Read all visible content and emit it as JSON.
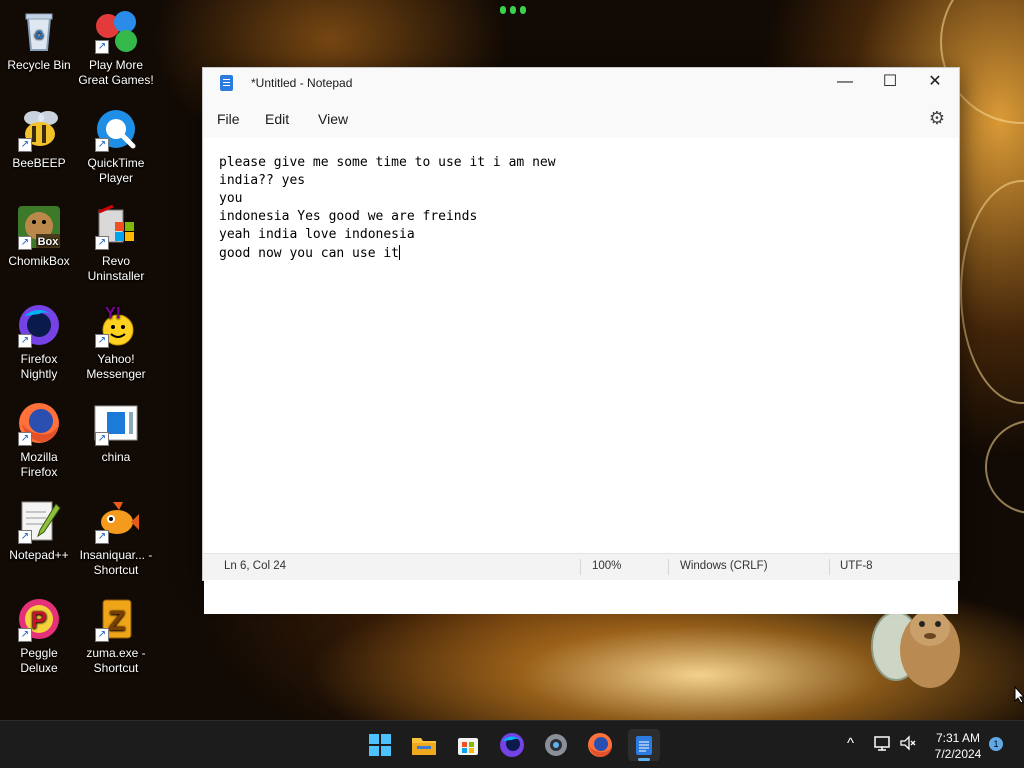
{
  "desktop": {
    "icons": [
      {
        "label": "Recycle Bin",
        "icon": "recycle-bin-icon"
      },
      {
        "label": "Play More Great Games!",
        "icon": "games-icon"
      },
      {
        "label": "BeeBEEP",
        "icon": "bee-icon"
      },
      {
        "label": "QuickTime Player",
        "icon": "quicktime-icon"
      },
      {
        "label": "ChomikBox",
        "icon": "hamster-icon"
      },
      {
        "label": "Revo Uninstaller",
        "icon": "revo-uninstaller-icon"
      },
      {
        "label": "Firefox Nightly",
        "icon": "firefox-nightly-icon"
      },
      {
        "label": "Yahoo! Messenger",
        "icon": "yahoo-messenger-icon"
      },
      {
        "label": "Mozilla Firefox",
        "icon": "firefox-icon"
      },
      {
        "label": "china",
        "icon": "document-window-icon"
      },
      {
        "label": "Notepad++",
        "icon": "notepadpp-icon"
      },
      {
        "label": "Insaniquar... - Shortcut",
        "icon": "fish-icon"
      },
      {
        "label": "Peggle Deluxe",
        "icon": "peggle-icon"
      },
      {
        "label": "zuma.exe - Shortcut",
        "icon": "zuma-icon"
      }
    ]
  },
  "notepad": {
    "title": "*Untitled - Notepad",
    "window_controls": {
      "minimize": "—",
      "maximize": "☐",
      "close": "✕"
    },
    "menu": [
      "File",
      "Edit",
      "View"
    ],
    "content_lines": [
      "please give me some time to use it i am new",
      "india?? yes",
      "you",
      "indonesia Yes good we are freinds",
      "yeah india love indonesia",
      "good now you can use it"
    ],
    "status": {
      "position": "Ln 6, Col 24",
      "zoom": "100%",
      "line_ending": "Windows (CRLF)",
      "encoding": "UTF-8"
    }
  },
  "taskbar": {
    "apps": [
      "start-icon",
      "file-explorer-icon",
      "store-icon",
      "firefox-nightly-icon",
      "settings-icon",
      "firefox-icon",
      "notepad-icon"
    ],
    "tray": {
      "chevron": "^"
    },
    "clock": {
      "time": "7:31 AM",
      "date": "7/2/2024"
    },
    "notification_count": "1"
  },
  "colors": {
    "accent": "#5fb2f2",
    "taskbar": "#1c1c1c",
    "window": "#f9f9f9"
  }
}
